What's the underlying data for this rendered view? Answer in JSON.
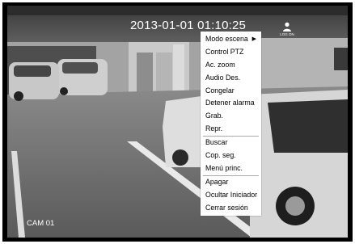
{
  "overlay": {
    "timestamp": "2013-01-01 01:10:25",
    "login_label": "LOG ON",
    "camera_label": "CAM 01"
  },
  "context_menu": {
    "groups": [
      [
        {
          "label": "Modo escena",
          "submenu": true
        },
        {
          "label": "Control PTZ"
        },
        {
          "label": "Ac. zoom"
        },
        {
          "label": "Audio Des."
        },
        {
          "label": "Congelar"
        },
        {
          "label": "Detener alarma"
        },
        {
          "label": "Grab."
        },
        {
          "label": "Repr."
        }
      ],
      [
        {
          "label": "Buscar"
        },
        {
          "label": "Cop. seg."
        },
        {
          "label": "Menú princ."
        }
      ],
      [
        {
          "label": "Apagar"
        },
        {
          "label": "Ocultar Iniciador"
        },
        {
          "label": "Cerrar sesión"
        }
      ]
    ],
    "submenu_arrow": "▶"
  },
  "icons": {
    "login": "user-icon",
    "submenu": "triangle-right-icon"
  }
}
